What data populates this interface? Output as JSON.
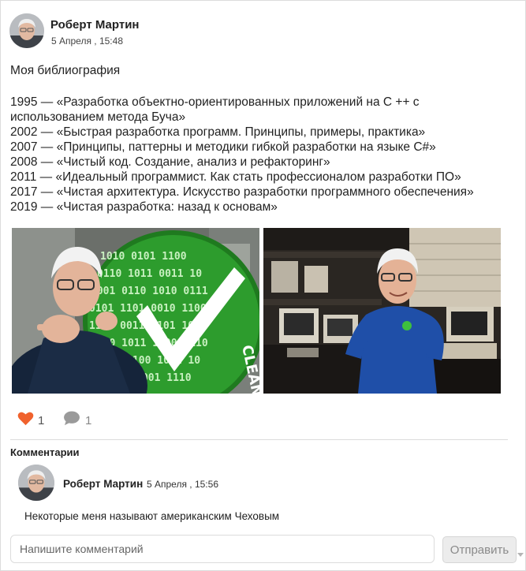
{
  "post": {
    "author": "Роберт Мартин",
    "date": "5 Апреля , 15:48",
    "title": "Моя библиография",
    "bibliography": [
      "1995 — «Разработка объектно-ориентированных приложений на C ++ с использованием метода Буча»",
      "2002 — «Быстрая разработка программ. Принципы, примеры, практика»",
      "2007 — «Принципы, паттерны и методики гибкой разработки на языке C#»",
      "2008 — «Чистый код. Создание, анализ и рефакторинг»",
      "2011 — «Идеальный программист. Как стать профессионалом разработки ПО»",
      "2017 — «Чистая архитектура. Искусство разработки программного обеспечения»",
      "2019 — «Чистая разработка: назад к основам»"
    ],
    "photo1_logo_text": "CLEAN CODE",
    "likes": "1",
    "comments_count": "1"
  },
  "comments": {
    "title": "Комментарии",
    "items": [
      {
        "author": "Роберт Мартин",
        "date": "5 Апреля , 15:56",
        "text": "Некоторые меня называют американским Чеховым"
      }
    ]
  },
  "form": {
    "placeholder": "Напишите комментарий",
    "send_label": "Отправить"
  },
  "icons": {
    "like": "heart-icon",
    "comment": "speech-bubble-icon"
  },
  "colors": {
    "like": "#f0622d",
    "comment_icon": "#9a9a9a",
    "divider": "#dcdcdc",
    "send_button_bg": "#ececec"
  }
}
